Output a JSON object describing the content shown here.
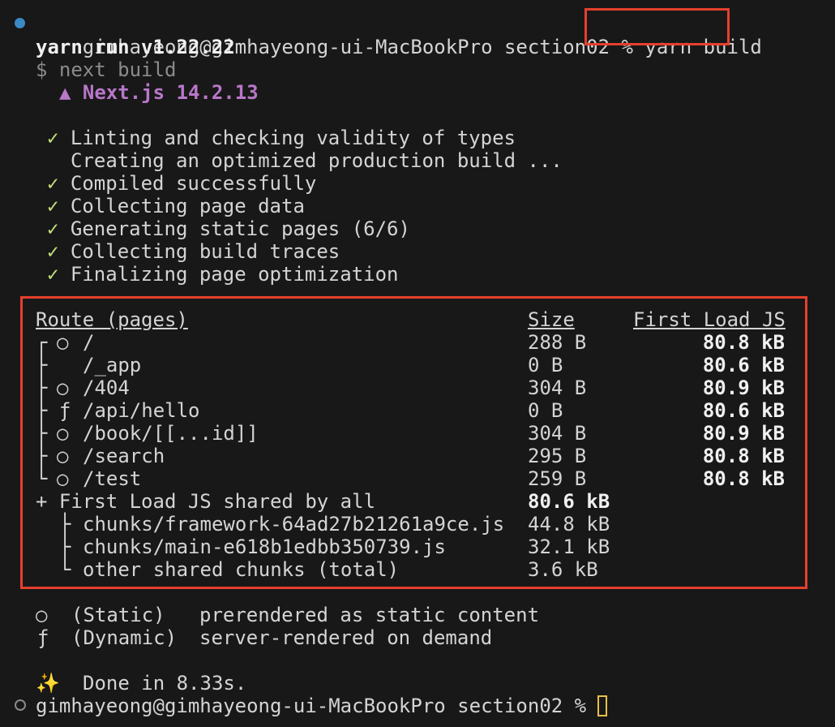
{
  "colors": {
    "background": "#181818",
    "highlight_box": "#e5402d",
    "check": "#c5e07a",
    "nextjs": "#b877c9",
    "cursor": "#e8c04a",
    "prompt_dot": "#3a8ac4"
  },
  "prompt1": {
    "text": "gimhayeong@gimhayeong-ui-MacBookPro section02 %",
    "command": "yarn build"
  },
  "yarn_version": "yarn run v1.22.22",
  "next_cmd": "$ next build",
  "nextjs_version": "▲ Next.js 14.2.13",
  "steps": [
    {
      "mark": "✓",
      "text": "Linting and checking validity of types"
    },
    {
      "mark": "",
      "text": "Creating an optimized production build ..."
    },
    {
      "mark": "✓",
      "text": "Compiled successfully"
    },
    {
      "mark": "✓",
      "text": "Collecting page data"
    },
    {
      "mark": "✓",
      "text": "Generating static pages (6/6)"
    },
    {
      "mark": "✓",
      "text": "Collecting build traces"
    },
    {
      "mark": "✓",
      "text": "Finalizing page optimization"
    }
  ],
  "table": {
    "headers": {
      "route": "Route (pages)",
      "size": "Size",
      "first_load": "First Load JS"
    },
    "rows": [
      {
        "tree": "┌",
        "icon": "○",
        "route": "/",
        "size": "288 B",
        "first_load": "80.8 kB"
      },
      {
        "tree": "├",
        "icon": "",
        "route": "/_app",
        "size": "0 B",
        "first_load": "80.6 kB"
      },
      {
        "tree": "├",
        "icon": "○",
        "route": "/404",
        "size": "304 B",
        "first_load": "80.9 kB"
      },
      {
        "tree": "├",
        "icon": "ƒ",
        "route": "/api/hello",
        "size": "0 B",
        "first_load": "80.6 kB"
      },
      {
        "tree": "├",
        "icon": "○",
        "route": "/book/[[...id]]",
        "size": "304 B",
        "first_load": "80.9 kB"
      },
      {
        "tree": "├",
        "icon": "○",
        "route": "/search",
        "size": "295 B",
        "first_load": "80.8 kB"
      },
      {
        "tree": "└",
        "icon": "○",
        "route": "/test",
        "size": "259 B",
        "first_load": "80.8 kB"
      }
    ],
    "shared": {
      "label": "+ First Load JS shared by all",
      "size": "80.6 kB"
    },
    "chunks": [
      {
        "tree": "├",
        "name": "chunks/framework-64ad27b21261a9ce.js",
        "size": "44.8 kB"
      },
      {
        "tree": "├",
        "name": "chunks/main-e618b1edbb350739.js",
        "size": "32.1 kB"
      },
      {
        "tree": "└",
        "name": "other shared chunks (total)",
        "size": "3.6 kB"
      }
    ]
  },
  "legend": [
    {
      "icon": "○",
      "type": "(Static)",
      "desc": "prerendered as static content"
    },
    {
      "icon": "ƒ",
      "type": "(Dynamic)",
      "desc": "server-rendered on demand"
    }
  ],
  "done": {
    "icon": "✨",
    "text": "Done in 8.33s."
  },
  "prompt2": {
    "text": "gimhayeong@gimhayeong-ui-MacBookPro section02 %"
  }
}
